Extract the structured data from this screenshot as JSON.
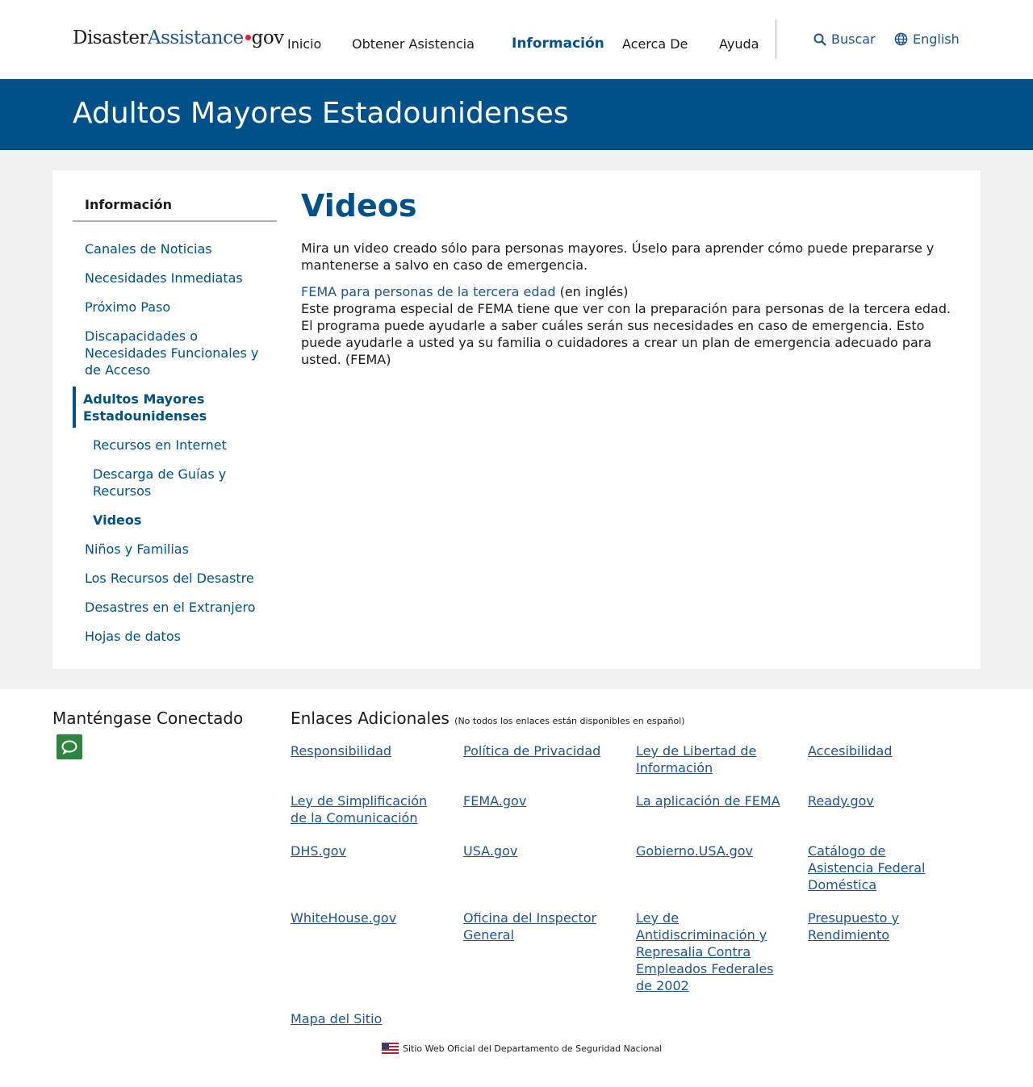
{
  "header": {
    "logo": {
      "part1": "Disaster",
      "part2": "Assistance",
      "part3": "gov"
    },
    "nav": [
      "Inicio",
      "Obtener Asistencia",
      "Información",
      "Acerca De",
      "Ayuda"
    ],
    "search_label": "Buscar",
    "language_label": "English"
  },
  "banner": {
    "title": "Adultos Mayores Estadounidenses"
  },
  "sidebar": {
    "heading": "Información",
    "items": [
      "Canales de Noticias",
      "Necesidades Inmediatas",
      "Próximo Paso",
      "Discapacidades o Necesidades Funcionales y de Acceso",
      "Adultos Mayores Estadounidenses",
      "Recursos en Internet",
      "Descarga de Guías y Recursos",
      "Videos",
      "Niños y Familias",
      "Los Recursos del Desastre",
      "Desastres en el Extranjero",
      "Hojas de datos"
    ]
  },
  "main": {
    "title": "Videos",
    "intro": "Mira un video creado sólo para personas mayores. Úselo para aprender cómo puede prepararse y mantenerse a salvo en caso de emergencia.",
    "video_link": "FEMA para personas de la tercera edad",
    "video_link_note": " (en inglés)",
    "video_desc": "Este programa especial de FEMA tiene que ver con la preparación para personas de la tercera edad. El programa puede ayudarle a saber cuáles serán sus necesidades en caso de emergencia. Esto puede ayudarle a usted ya su familia o cuidadores a crear un plan de emergencia adecuado para usted. (FEMA)"
  },
  "footer": {
    "connected_heading": "Manténgase Conectado",
    "links_heading": "Enlaces Adicionales",
    "links_note": "(No todos los enlaces están disponibles en español)",
    "links": [
      "Responsibilidad",
      "Política de Privacidad",
      "Ley de Libertad de Información",
      "Accesibilidad",
      "Ley de Simplificación de la Comunicación",
      "FEMA.gov",
      "La aplicación de FEMA",
      "Ready.gov",
      "DHS.gov",
      "USA.gov",
      "Gobierno.USA.gov",
      "Catálogo de Asistencia Federal Doméstica",
      "WhiteHouse.gov",
      "Oficina del Inspector General",
      "Ley de Antidiscriminación y Represalia Contra Empleados Federales de 2002",
      "Presupuesto y Rendimiento",
      "Mapa del Sitio"
    ],
    "official_text": "Sitio Web Oficial del Departamento de Seguridad Nacional"
  },
  "colors": {
    "primary": "#005189",
    "link": "#205493",
    "accent_dot": "#e31c3d",
    "chat_green": "#2e8540",
    "grey_bg": "#f1f1f1"
  }
}
